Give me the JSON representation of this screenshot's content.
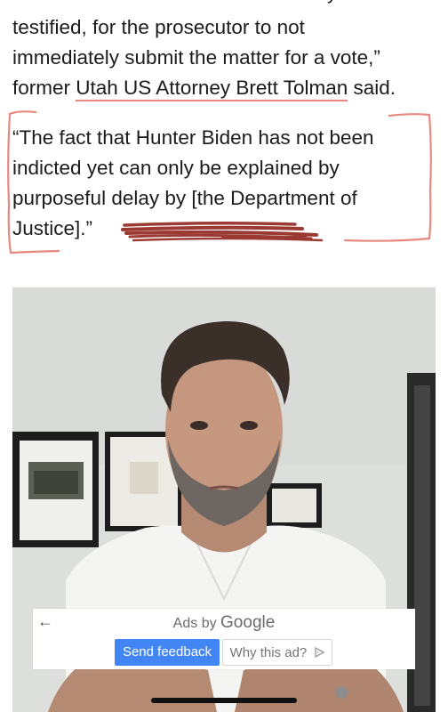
{
  "article": {
    "clipped_top_line": "... the ... of the ... who had ... already",
    "para1": {
      "line1": "testified, for the prosecutor to not",
      "line2": "immediately submit the matter for a vote,”",
      "line3_prefix": "former ",
      "line3_link": "Utah US Attorney Brett Tolman",
      "line3_suffix": " said."
    },
    "quote": {
      "line1": "“The fact that Hunter Biden has not been",
      "line2": "indicted yet can only be explained by",
      "line3": "purposeful delay by [the Department of",
      "line4": "Justice].”"
    }
  },
  "annotation_color": "#e8897f",
  "redaction_color": "#9b3a33",
  "ad": {
    "back_icon": "back-arrow-icon",
    "title_prefix": "Ads by ",
    "title_brand": "Google",
    "feedback_label": "Send feedback",
    "why_label": "Why this ad?",
    "why_icon": "adchoices-icon",
    "feedback_color": "#4285f4"
  }
}
